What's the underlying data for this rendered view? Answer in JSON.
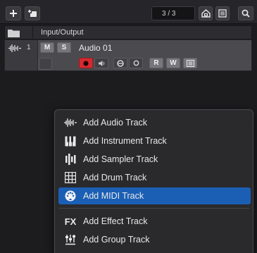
{
  "toolbar": {
    "track_counter": "3 / 3"
  },
  "track_list": {
    "header_label": "Input/Output"
  },
  "track": {
    "number": "1",
    "name": "Audio 01",
    "mute_label": "M",
    "solo_label": "S",
    "read_label": "R",
    "write_label": "W",
    "record_enabled": true
  },
  "menu": {
    "items": [
      {
        "label": "Add Audio Track",
        "icon": "audio-wave-icon",
        "selected": false
      },
      {
        "label": "Add Instrument Track",
        "icon": "piano-keys-icon",
        "selected": false
      },
      {
        "label": "Add Sampler Track",
        "icon": "sampler-icon",
        "selected": false
      },
      {
        "label": "Add Drum Track",
        "icon": "drum-grid-icon",
        "selected": false
      },
      {
        "label": "Add MIDI Track",
        "icon": "midi-port-icon",
        "selected": true
      },
      {
        "label": "Add Effect Track",
        "icon": "fx-icon",
        "fx_text": "FX",
        "selected": false
      },
      {
        "label": "Add Group Track",
        "icon": "group-faders-icon",
        "selected": false
      }
    ]
  },
  "colors": {
    "accent_selection": "#1b5fb5",
    "record_red": "#d42a30",
    "background": "#1c1c1e"
  }
}
